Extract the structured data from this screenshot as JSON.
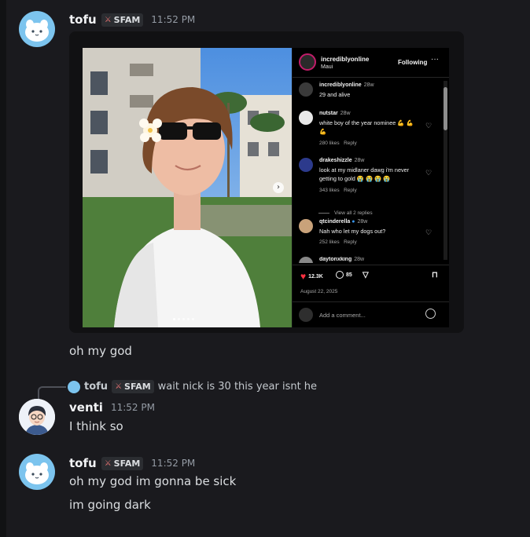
{
  "messages": [
    {
      "username": "tofu",
      "tag": "SFAM",
      "time": "11:52 PM",
      "lines": [
        "oh my god"
      ]
    },
    {
      "reply_to": {
        "username": "tofu",
        "tag": "SFAM",
        "text": "wait nick is 30 this year isnt he"
      },
      "username": "venti",
      "time": "11:52 PM",
      "lines": [
        "I think so"
      ]
    },
    {
      "username": "tofu",
      "tag": "SFAM",
      "time": "11:52 PM",
      "lines": [
        "oh my god im gonna be sick",
        "im going dark"
      ]
    }
  ],
  "embed": {
    "account": "incrediblyonline",
    "location": "Maui",
    "follow_label": "Following",
    "comments": [
      {
        "user": "incrediblyonline",
        "age": "28w",
        "text": "29 and alive",
        "likes": "",
        "reply": ""
      },
      {
        "user": "nutstar",
        "age": "28w",
        "text": "white boy of the year nominee 💪 💪 💪",
        "likes": "280 likes",
        "reply": "Reply"
      },
      {
        "user": "drakeshizzle",
        "age": "28w",
        "text": "look at my midlaner dawg i'm never getting to gold 😭 😭 😭 😭",
        "likes": "343 likes",
        "reply": "Reply"
      },
      {
        "user": "qtcinderella",
        "age": "28w",
        "text": "Nah who let my dogs out?",
        "likes": "252 likes",
        "reply": "Reply"
      },
      {
        "user": "daytonxking",
        "age": "28w",
        "text": "",
        "likes": "",
        "reply": ""
      }
    ],
    "view_replies": "View all 2 replies",
    "like_count": "12.3K",
    "comment_count": "85",
    "date": "August 22, 2025",
    "add_comment_placeholder": "Add a comment..."
  }
}
